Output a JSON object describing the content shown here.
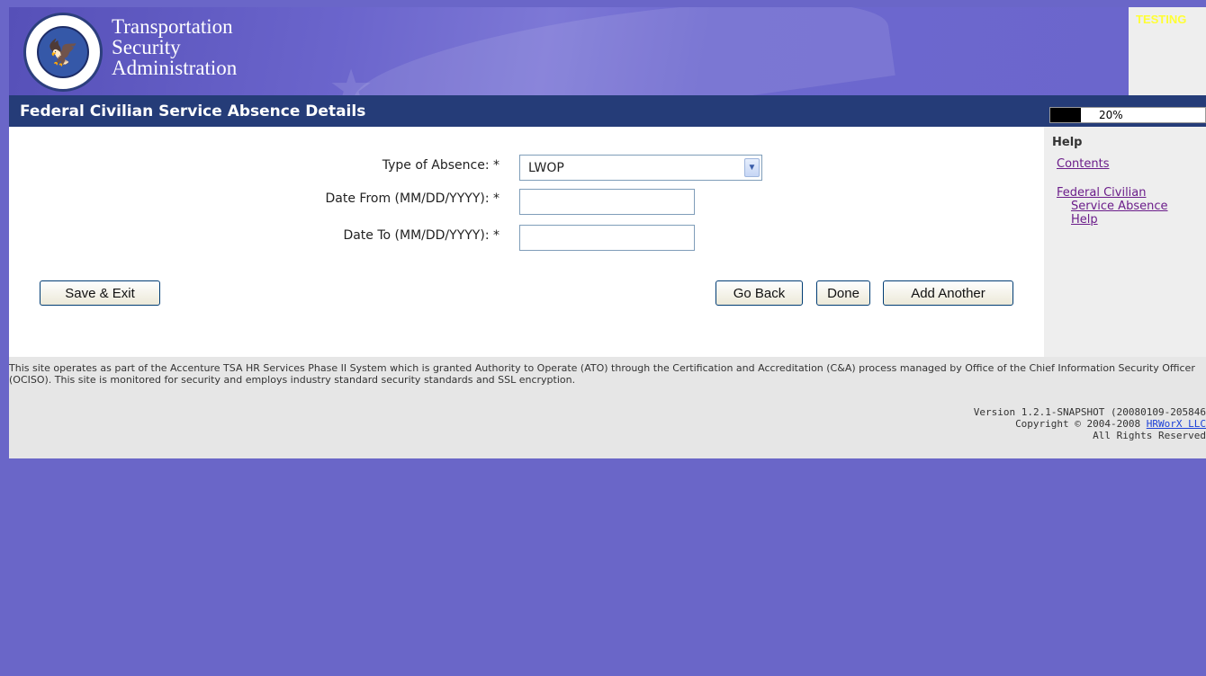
{
  "header": {
    "agency_lines": [
      "Transportation",
      "Security",
      "Administration"
    ],
    "testing_label": "TESTING",
    "seal_icon": "dhs-seal-icon"
  },
  "title_bar": {
    "title": "Federal Civilian Service Absence Details",
    "progress_value": 0.2,
    "progress_label": "20%"
  },
  "sidebar": {
    "heading": "Help",
    "links": {
      "contents": "Contents",
      "fcs_line1": "Federal Civilian",
      "fcs_line2": "Service Absence",
      "fcs_line3": "Help"
    }
  },
  "form": {
    "type_label": "Type of Absence: *",
    "type_value": "LWOP",
    "date_from_label": "Date From (MM/DD/YYYY): *",
    "date_from_value": "",
    "date_to_label": "Date To (MM/DD/YYYY): *",
    "date_to_value": ""
  },
  "buttons": {
    "save_exit": "Save & Exit",
    "go_back": "Go Back",
    "done": "Done",
    "add_another": "Add Another"
  },
  "footer": {
    "disclaimer": "This site operates as part of the Accenture TSA HR Services Phase II System which is granted Authority to Operate (ATO) through the Certification and Accreditation (C&A) process managed by Office of the Chief Information Security Officer (OCISO). This site is monitored for security and employs industry standard security standards and SSL encryption.",
    "version": "Version 1.2.1-SNAPSHOT (20080109-205846",
    "copyright_prefix": "Copyright © 2004-2008 ",
    "vendor": "HRWorX LLC",
    "rights": "All Rights Reserved"
  },
  "colors": {
    "page_background": "#6a66c8",
    "title_bar": "#253c78",
    "testing_text": "#ffff33",
    "visited_link": "#6b1d8a"
  }
}
